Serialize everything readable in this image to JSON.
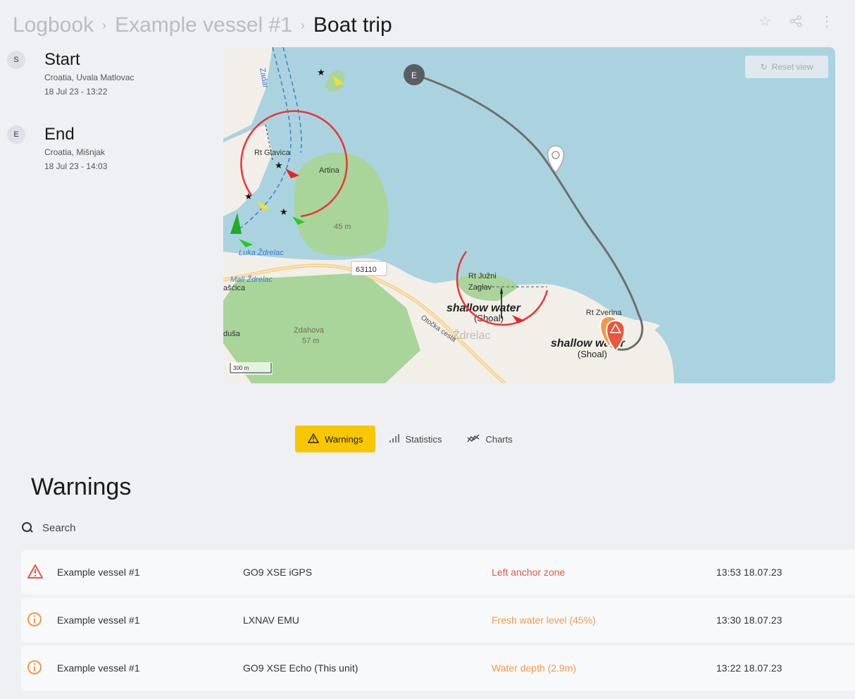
{
  "breadcrumb": {
    "items": [
      "Logbook",
      "Example vessel #1"
    ],
    "current": "Boat trip"
  },
  "header_icons": [
    "star-icon",
    "share-icon",
    "more-vertical-icon"
  ],
  "trip": {
    "start": {
      "badge": "S",
      "title": "Start",
      "location": "Croatia, Uvala Matlovac",
      "time": "18 Jul 23 - 13:22"
    },
    "end": {
      "badge": "E",
      "title": "End",
      "location": "Croatia, Mišnjak",
      "time": "18 Jul 23 - 14:03"
    }
  },
  "map": {
    "reset_label": "Reset view",
    "end_marker": "E",
    "labels": {
      "zadar": "Zadar",
      "rt_glavica": "Rt Glavica",
      "artina": "Artina",
      "elev_45": "45 m",
      "luka_zdrelac": "Luka Ždrelac",
      "mali_zdrelac": "Mali Ždrelac",
      "ascica": "ašćica",
      "road": "63110",
      "rt_juzni": "Rt Južni",
      "zaglav": "Zaglav",
      "shallow1": "shallow water",
      "shoal1": "(Shoal)",
      "zdrelac": "Ždrelac",
      "otocka": "Otočka cesta",
      "rt_zverina": "Rt Zverina",
      "shallow2": "shallow water",
      "shoal2": "(Shoal)",
      "dusa": "duša",
      "zdahova": "Zdahova",
      "elev_57": "57 m",
      "scale": "300 m"
    }
  },
  "tabs": [
    {
      "label": "Warnings",
      "icon": "warning-icon",
      "active": true
    },
    {
      "label": "Statistics",
      "icon": "bar-chart-icon",
      "active": false
    },
    {
      "label": "Charts",
      "icon": "line-chart-icon",
      "active": false
    }
  ],
  "warnings": {
    "title": "Warnings",
    "search_placeholder": "Search",
    "rows": [
      {
        "severity": "alert",
        "vessel": "Example vessel #1",
        "device": "GO9 XSE iGPS",
        "message": "Left anchor zone",
        "time": "13:53 18.07.23",
        "color": "#e9573f"
      },
      {
        "severity": "info",
        "vessel": "Example vessel #1",
        "device": "LXNAV EMU",
        "message": "Fresh water level (45%)",
        "time": "13:30 18.07.23",
        "color": "#f2994a"
      },
      {
        "severity": "info",
        "vessel": "Example vessel #1",
        "device": "GO9 XSE Echo (This unit)",
        "message": "Water depth (2.9m)",
        "time": "13:22 18.07.23",
        "color": "#f2994a"
      }
    ]
  }
}
